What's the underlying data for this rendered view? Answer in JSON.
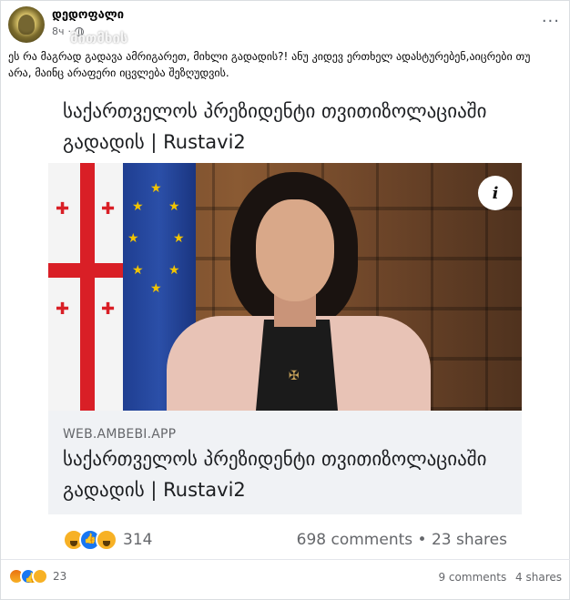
{
  "post": {
    "author": "დედოფალი",
    "time": "8ч",
    "watermark": "მითმხის",
    "caption": "ეს რა მაგრად გადავა ამრიგარეთ, მიხლი გადადის?! ანუ კიდევ ერთხელ ადასტურებენ,აიცრები თუ არა, მაინც არაფერი იცვლება შეზღუდვის.",
    "more_label": "···"
  },
  "shared_link": {
    "headline": "საქართველოს პრეზიდენტი თვითიზოლაციაში გადადის | Rustavi2",
    "domain": "WEB.AMBEBI.APP",
    "info_label": "i",
    "reaction_icons": [
      "haha-icon",
      "like-icon",
      "wow-icon"
    ],
    "reaction_count": "314",
    "comments": "698 comments",
    "separator": "•",
    "shares": "23 shares"
  },
  "post_stats": {
    "reaction_icons": [
      "angry-icon",
      "like-icon",
      "sad-icon"
    ],
    "reaction_count": "23",
    "comments": "9 comments",
    "shares": "4 shares"
  },
  "colors": {
    "facebook_blue": "#1877f2",
    "secondary_text": "#65676b",
    "link_box_bg": "#f0f2f5"
  }
}
